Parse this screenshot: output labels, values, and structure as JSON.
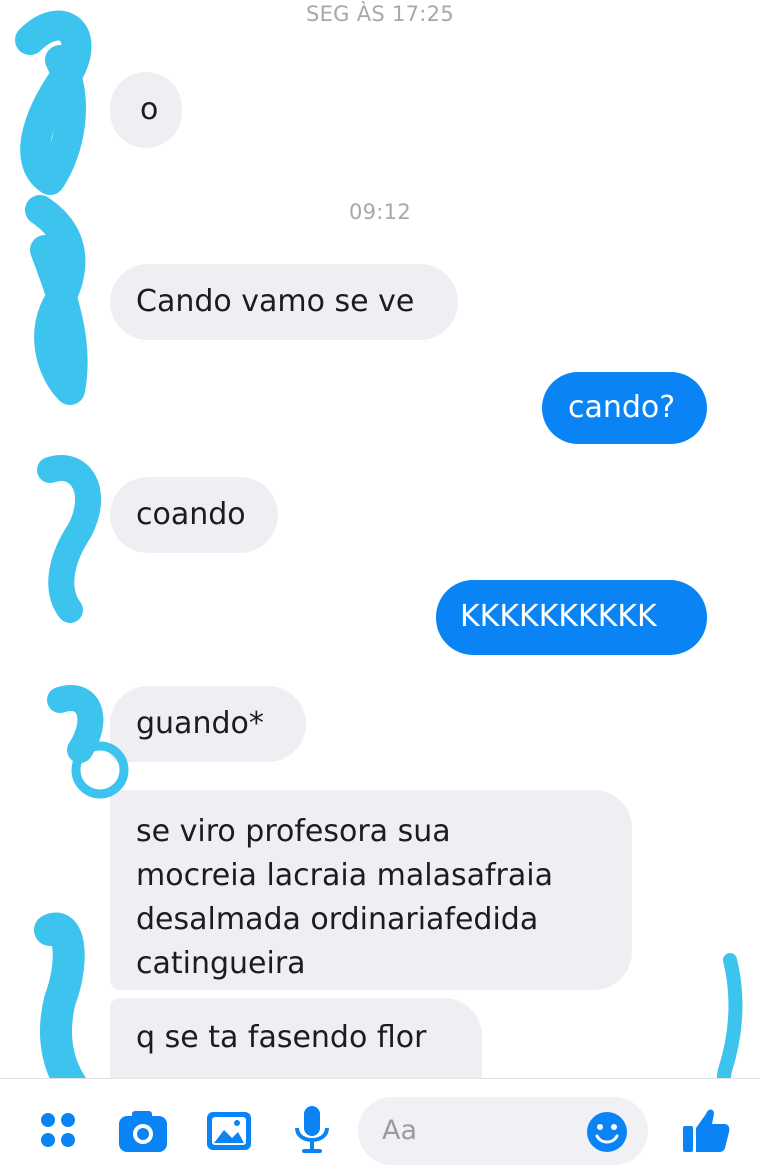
{
  "conversation": {
    "timestamp_top": "SEG ÀS 17:25",
    "timestamp_mid": "09:12",
    "messages": [
      {
        "side": "in",
        "lines": [
          "o"
        ]
      },
      {
        "side": "in",
        "lines": [
          "Cando vamo se ve"
        ]
      },
      {
        "side": "out",
        "lines": [
          "cando?"
        ]
      },
      {
        "side": "in",
        "lines": [
          "coando"
        ]
      },
      {
        "side": "out",
        "lines": [
          "KKKKKKKKKK"
        ]
      },
      {
        "side": "in",
        "lines": [
          "guando*"
        ]
      },
      {
        "side": "in",
        "lines": [
          "se viro profesora sua",
          "mocreia lacraia malasafraia",
          "desalmada ordinariafedida",
          "catingueira"
        ]
      },
      {
        "side": "in",
        "lines": [
          "q se ta fasendo flor"
        ]
      }
    ]
  },
  "composer": {
    "placeholder": "Aa",
    "accent": "#0a84f4",
    "icons": [
      "menu-dots-icon",
      "camera-icon",
      "gallery-icon",
      "microphone-icon",
      "emoji-icon",
      "thumbs-up-icon"
    ]
  },
  "colors": {
    "outgoing_bubble": "#0a84f4",
    "incoming_bubble": "#eeeff2",
    "scribble": "#3cc3ee"
  }
}
